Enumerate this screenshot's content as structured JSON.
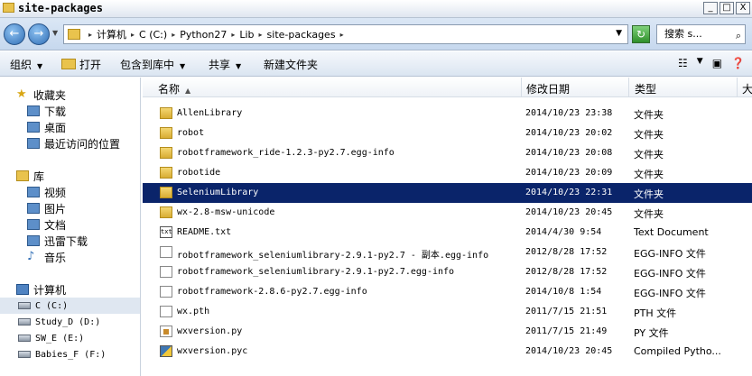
{
  "window": {
    "title": "site-packages",
    "controls": {
      "minimize": "_",
      "maximize": "□",
      "close": "X"
    }
  },
  "address": {
    "back_icon": "back-arrow-icon",
    "forward_icon": "forward-arrow-icon",
    "crumbs": [
      "计算机",
      "C (C:)",
      "Python27",
      "Lib",
      "site-packages"
    ],
    "search_placeholder": "搜索 s..."
  },
  "toolbar": {
    "organize": "组织",
    "open": "打开",
    "include_in_library": "包含到库中",
    "share": "共享",
    "new_folder": "新建文件夹"
  },
  "sidebar": {
    "favorites": "收藏夹",
    "downloads": "下载",
    "desktop": "桌面",
    "recent": "最近访问的位置",
    "libraries": "库",
    "videos": "视频",
    "pictures": "图片",
    "documents": "文档",
    "xunlei": "迅雷下载",
    "music": "音乐",
    "computer": "计算机",
    "drive_c": "C (C:)",
    "drive_d": "Study_D (D:)",
    "drive_e": "SW_E (E:)",
    "drive_f": "Babies_F (F:)"
  },
  "columns": {
    "name": "名称",
    "date": "修改日期",
    "type": "类型",
    "size": "大"
  },
  "files": [
    {
      "name": "AllenLibrary",
      "date": "2014/10/23 23:38",
      "type": "文件夹",
      "icon": "folder"
    },
    {
      "name": "robot",
      "date": "2014/10/23 20:02",
      "type": "文件夹",
      "icon": "folder"
    },
    {
      "name": "robotframework_ride-1.2.3-py2.7.egg-info",
      "date": "2014/10/23 20:08",
      "type": "文件夹",
      "icon": "folder"
    },
    {
      "name": "robotide",
      "date": "2014/10/23 20:09",
      "type": "文件夹",
      "icon": "folder"
    },
    {
      "name": "SeleniumLibrary",
      "date": "2014/10/23 22:31",
      "type": "文件夹",
      "icon": "folder",
      "selected": true
    },
    {
      "name": "wx-2.8-msw-unicode",
      "date": "2014/10/23 20:45",
      "type": "文件夹",
      "icon": "folder"
    },
    {
      "name": "README.txt",
      "date": "2014/4/30 9:54",
      "type": "Text Document",
      "icon": "txt"
    },
    {
      "name": "robotframework_seleniumlibrary-2.9.1-py2.7 - 副本.egg-info",
      "date": "2012/8/28 17:52",
      "type": "EGG-INFO 文件",
      "icon": "file"
    },
    {
      "name": "robotframework_seleniumlibrary-2.9.1-py2.7.egg-info",
      "date": "2012/8/28 17:52",
      "type": "EGG-INFO 文件",
      "icon": "file"
    },
    {
      "name": "robotframework-2.8.6-py2.7.egg-info",
      "date": "2014/10/8 1:54",
      "type": "EGG-INFO 文件",
      "icon": "file"
    },
    {
      "name": "wx.pth",
      "date": "2011/7/15 21:51",
      "type": "PTH 文件",
      "icon": "file"
    },
    {
      "name": "wxversion.py",
      "date": "2011/7/15 21:49",
      "type": "PY 文件",
      "icon": "py"
    },
    {
      "name": "wxversion.pyc",
      "date": "2014/10/23 20:45",
      "type": "Compiled Pytho...",
      "icon": "pyc"
    }
  ],
  "colors": {
    "selection": "#0a246a",
    "folder": "#e9c34d",
    "toolbar": "#dbe5f1"
  }
}
